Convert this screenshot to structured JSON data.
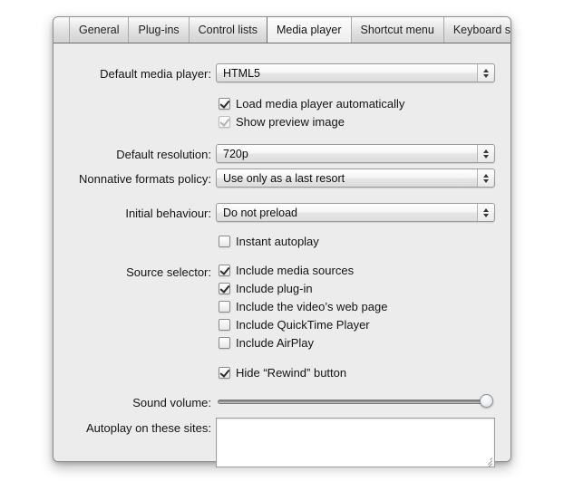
{
  "window": {
    "tabs": [
      {
        "label": "General",
        "selected": false
      },
      {
        "label": "Plug-ins",
        "selected": false
      },
      {
        "label": "Control lists",
        "selected": false
      },
      {
        "label": "Media player",
        "selected": true
      },
      {
        "label": "Shortcut menu",
        "selected": false
      },
      {
        "label": "Keyboard shortcuts",
        "selected": false
      }
    ]
  },
  "form": {
    "default_media_player": {
      "label": "Default media player:",
      "value": "HTML5"
    },
    "load_automatically": {
      "label": "Load media player automatically",
      "checked": true,
      "enabled": true
    },
    "show_preview_image": {
      "label": "Show preview image",
      "checked": true,
      "enabled": false
    },
    "default_resolution": {
      "label": "Default resolution:",
      "value": "720p"
    },
    "nonnative_formats_policy": {
      "label": "Nonnative formats policy:",
      "value": "Use only as a last resort"
    },
    "initial_behaviour": {
      "label": "Initial behaviour:",
      "value": "Do not preload"
    },
    "instant_autoplay": {
      "label": "Instant autoplay",
      "checked": false,
      "enabled": true
    },
    "source_selector": {
      "label": "Source selector:",
      "items": [
        {
          "label": "Include media sources",
          "checked": true
        },
        {
          "label": "Include plug-in",
          "checked": true
        },
        {
          "label": "Include the video’s web page",
          "checked": false
        },
        {
          "label": "Include QuickTime Player",
          "checked": false
        },
        {
          "label": "Include AirPlay",
          "checked": false
        }
      ]
    },
    "hide_rewind": {
      "label": "Hide “Rewind” button",
      "checked": true
    },
    "sound_volume": {
      "label": "Sound volume:",
      "value": 100
    },
    "autoplay_sites": {
      "label": "Autoplay on these sites:",
      "value": "",
      "placeholder": ""
    }
  },
  "colors": {
    "window_bg": "#ececec",
    "selected_tab_bg": "#f5f5f5",
    "text": "#141414",
    "disabled_text": "#8f8f8f"
  }
}
